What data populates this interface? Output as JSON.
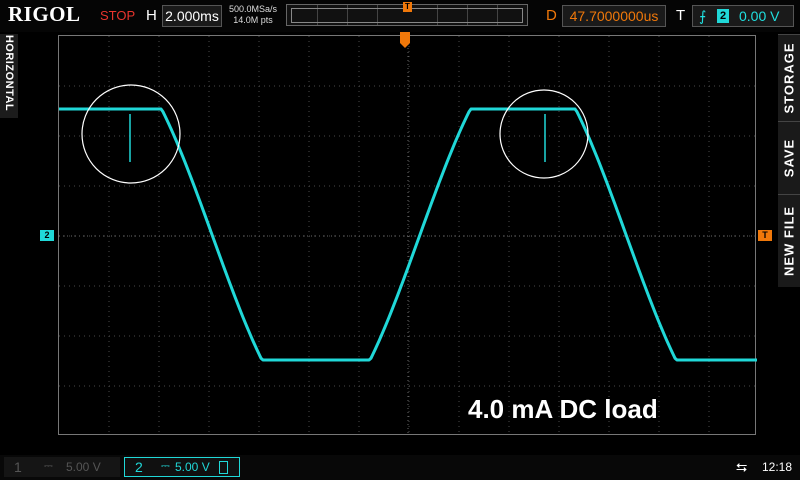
{
  "header": {
    "brand": "RIGOL",
    "run_status": "STOP",
    "h_label": "H",
    "timebase": "2.000ms",
    "sample_rate": "500.0MSa/s",
    "memory_depth": "14.0M pts",
    "delay_label": "D",
    "delay": "47.7000000us",
    "trigger_label": "T",
    "trigger_channel": "2",
    "trigger_level": "0.00 V",
    "trigger_edge_icon": "rising-edge-icon",
    "trigger_marker": "T"
  },
  "left_tab": {
    "label": "HORIZONTAL"
  },
  "right_menu": {
    "items": [
      {
        "label": "STORAGE"
      },
      {
        "label": "SAVE"
      },
      {
        "label": "NEW FILE"
      }
    ]
  },
  "screen": {
    "annotation": "4.0 mA  DC load",
    "ch2_ground_marker": "2",
    "trigger_level_marker": "T"
  },
  "channels": [
    {
      "num": "1",
      "coupling": "⎓",
      "scale": "5.00 V",
      "active": false
    },
    {
      "num": "2",
      "coupling": "⎓",
      "scale": "5.00 V",
      "active": true
    }
  ],
  "status": {
    "usb_icon": "usb-icon",
    "time": "12:18"
  },
  "colors": {
    "trace": "#20d8d8",
    "trigger": "#f0780a",
    "stop": "#e8342d",
    "grid": "#555555"
  }
}
